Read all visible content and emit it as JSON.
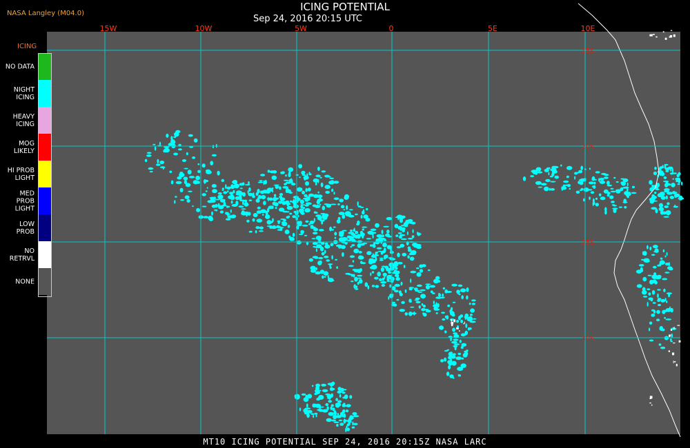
{
  "header": {
    "credit": "NASA Langley (M04.0)",
    "title": "ICING POTENTIAL",
    "datetime": "Sep 24, 2016 20:15 UTC"
  },
  "footer": {
    "text": "MT10  ICING POTENTIAL   SEP 24, 2016 20:15Z   NASA LARC"
  },
  "legend": {
    "title": "ICING",
    "items": [
      {
        "label": "NO DATA",
        "color": "#1eb81e"
      },
      {
        "label": "NIGHT\nICING",
        "color": "#00ffff"
      },
      {
        "label": "HEAVY\nICING",
        "color": "#e7a6e0"
      },
      {
        "label": "MOG\nLIKELY",
        "color": "#ff0000"
      },
      {
        "label": "HI PROB\nLIGHT",
        "color": "#ffff00"
      },
      {
        "label": "MED PROB\nLIGHT",
        "color": "#0000ff"
      },
      {
        "label": "LOW\nPROB",
        "color": "#000080"
      },
      {
        "label": "NO\nRETRVL",
        "color": "#ffffff"
      },
      {
        "label": "NONE",
        "color": "#555555"
      }
    ]
  },
  "map": {
    "lon_labels": [
      "15W",
      "10W",
      "5W",
      "0",
      "5E",
      "10E"
    ],
    "lat_labels": [
      "15S",
      "20S",
      "25S",
      "30S"
    ],
    "colors": {
      "background": "#555555",
      "grid": "#00cccc",
      "icing": "#00ffff",
      "cloud_white": "#ffffff",
      "coast": "#ffffff",
      "lon_label": "#ff3b1e",
      "lat_label": "#cc2a1a"
    }
  }
}
